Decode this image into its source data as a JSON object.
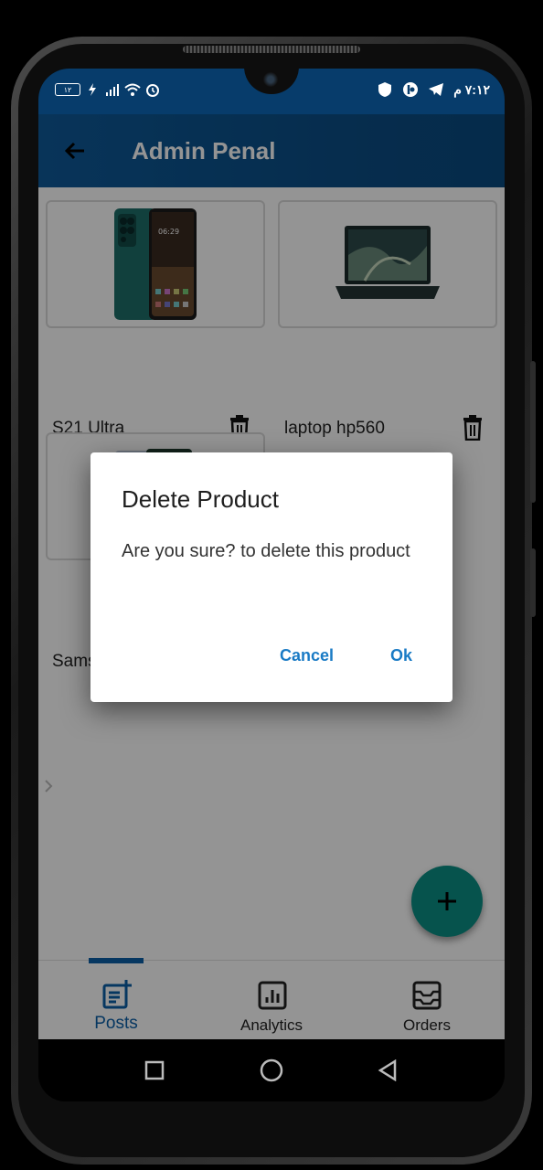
{
  "status_bar": {
    "battery": "١٢",
    "time": "٧:١٢ م"
  },
  "app_bar": {
    "title": "Admin Penal"
  },
  "products": [
    {
      "name": "S21 Ultra"
    },
    {
      "name": "laptop hp560"
    },
    {
      "name": "Sams"
    }
  ],
  "bottom_nav": {
    "items": [
      {
        "label": "Posts",
        "active": true
      },
      {
        "label": "Analytics",
        "active": false
      },
      {
        "label": "Orders",
        "active": false
      }
    ]
  },
  "dialog": {
    "title": "Delete Product",
    "message": "Are you sure? to delete this product",
    "cancel_label": "Cancel",
    "ok_label": "Ok"
  },
  "colors": {
    "app_bar": "#0e5a9a",
    "status_bar": "#073c6b",
    "fab": "#0b8f86",
    "active_nav": "#0c5fa8",
    "dialog_button": "#1a7bc5"
  },
  "icons": {
    "back": "arrow-left-icon",
    "delete": "trash-icon",
    "fab": "plus-icon",
    "posts": "post-add-icon",
    "analytics": "analytics-icon",
    "orders": "orders-icon"
  }
}
